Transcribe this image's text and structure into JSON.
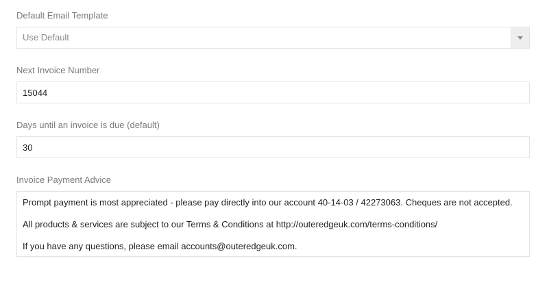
{
  "email_template": {
    "label": "Default Email Template",
    "selected": "Use Default",
    "icon": "chevron-down-icon"
  },
  "invoice_number": {
    "label": "Next Invoice Number",
    "value": "15044"
  },
  "due_days": {
    "label": "Days until an invoice is due (default)",
    "value": "30"
  },
  "payment_advice": {
    "label": "Invoice Payment Advice",
    "lines": [
      "Prompt payment is most appreciated - please pay directly into our account 40-14-03 / 42273063. Cheques are not accepted.",
      "All products & services are subject to our Terms & Conditions at http://outeredgeuk.com/terms-conditions/",
      "If you have any questions, please email accounts@outeredgeuk.com."
    ]
  }
}
